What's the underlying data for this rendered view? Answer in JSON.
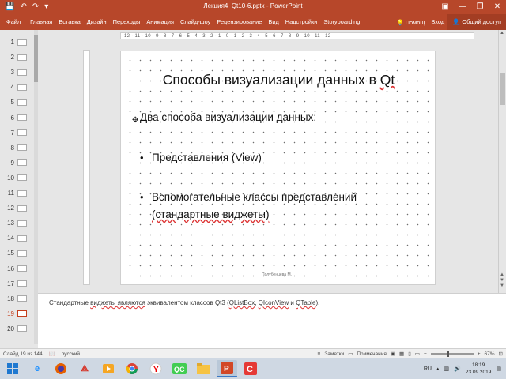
{
  "window": {
    "title": "Лекция4_Qt10-6.pptx - PowerPoint",
    "minimize": "—",
    "restore": "❐",
    "close": "✕"
  },
  "qat": {
    "save_icon": "save-icon",
    "undo_icon": "undo-icon",
    "redo_icon": "redo-icon"
  },
  "ribbon": {
    "tabs": [
      "Файл",
      "Главная",
      "Вставка",
      "Дизайн",
      "Переходы",
      "Анимация",
      "Слайд-шоу",
      "Рецензирование",
      "Вид",
      "Надстройки",
      "Storyboarding"
    ],
    "tell_me": "Помощ",
    "sign_in": "Вход",
    "share": "Общий доступ"
  },
  "thumbnails": {
    "numbers": [
      "1",
      "2",
      "3",
      "4",
      "5",
      "6",
      "7",
      "8",
      "9",
      "10",
      "11",
      "12",
      "13",
      "14",
      "15",
      "16",
      "17",
      "18",
      "19",
      "20"
    ],
    "current_index": 18
  },
  "ruler": {
    "marks": "12 · 11 · 10 · 9 · 8 · 7 · 6 · 5 · 4 · 3 · 2 · 1 · 0 · 1 · 2 · 3 · 4 · 5 · 6 · 7 · 8 · 9 · 10 · 11 · 12"
  },
  "slide": {
    "title_main": "Способы визуализации данных в ",
    "title_qt": "Qt",
    "intro": "Два способа визуализации данных:",
    "bullet_char": "•",
    "bullet1": "Представления (View)",
    "bullet2_line1": "Вспомогательные классы представлений",
    "bullet2_line2": "(стандартные виджеты)",
    "footer": "Полубенцева М."
  },
  "notes": {
    "p1": "Стандартные ",
    "p2": "виджеты являются",
    "p3": " эквивалентом классов Qt3 (",
    "p4": "QListBox",
    "p5": ", ",
    "p6": "QIconView",
    "p7": "   и ",
    "p8": "QTable",
    "p9": ")."
  },
  "status": {
    "slide_info": "Слайд 19 из 144",
    "language": "русский",
    "notes_btn": "Заметки",
    "comments_btn": "Примечания",
    "zoom": "67%"
  },
  "taskbar": {
    "lang": "RU",
    "time": "18:19",
    "date": "23.09.2019",
    "apps": [
      "ie",
      "firefox",
      "pdf",
      "media",
      "chrome",
      "yandex",
      "qt",
      "files",
      "powerpoint",
      "screencast"
    ]
  },
  "colors": {
    "accent": "#b7472a",
    "current_slide": "#c43e1c"
  }
}
